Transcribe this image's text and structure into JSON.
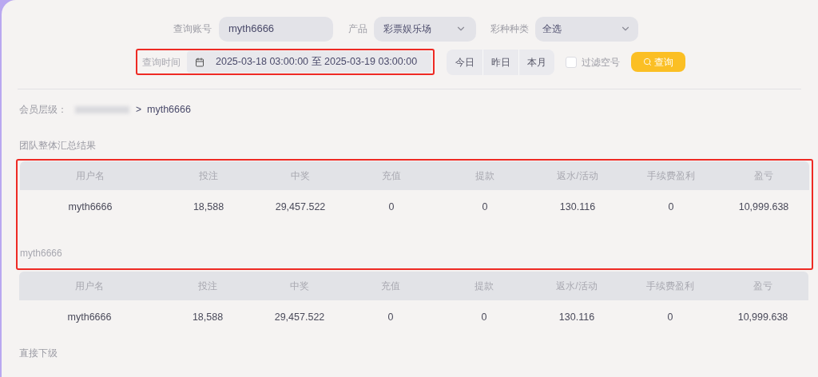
{
  "filters": {
    "account": {
      "label": "查询账号",
      "value": "myth6666"
    },
    "product": {
      "label": "产品",
      "value": "彩票娱乐场"
    },
    "lottery_type": {
      "label": "彩种种类",
      "value": "全选"
    },
    "time": {
      "label": "查询时间",
      "value": "2025-03-18 03:00:00 至 2025-03-19 03:00:00",
      "highlighted": true
    },
    "quick_ranges": [
      {
        "label": "今日",
        "selected": false
      },
      {
        "label": "昨日",
        "selected": false
      },
      {
        "label": "本月",
        "selected": false
      }
    ],
    "filter_empty": {
      "label": "过滤空号",
      "checked": false
    },
    "search_button": "查询"
  },
  "breadcrumb": {
    "label": "会员层级：",
    "separator": ">",
    "current": "myth6666"
  },
  "sections": [
    {
      "title": "团队整体汇总结果",
      "highlighted": true,
      "columns": [
        "用户名",
        "投注",
        "中奖",
        "充值",
        "提款",
        "返水/活动",
        "手续费盈利",
        "盈亏"
      ],
      "rows": [
        [
          "myth6666",
          "18,588",
          "29,457.522",
          "0",
          "0",
          "130.116",
          "0",
          "10,999.638"
        ]
      ]
    },
    {
      "title": "myth6666",
      "columns": [
        "用户名",
        "投注",
        "中奖",
        "充值",
        "提款",
        "返水/活动",
        "手续费盈利",
        "盈亏"
      ],
      "rows": [
        [
          "myth6666",
          "18,588",
          "29,457.522",
          "0",
          "0",
          "130.116",
          "0",
          "10,999.638"
        ]
      ]
    },
    {
      "title": "直接下级"
    }
  ]
}
